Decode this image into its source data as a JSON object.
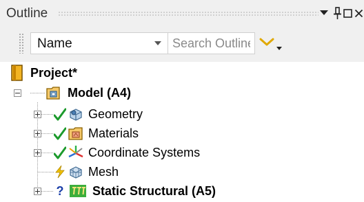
{
  "panel": {
    "title": "Outline",
    "icons": [
      "dropdown-arrow-icon",
      "pin-icon",
      "maximize-icon",
      "close-icon"
    ]
  },
  "toolbar": {
    "name_select_value": "Name",
    "search_placeholder": "Search Outline",
    "icons": [
      "chevron-down-icon",
      "filter-options-icon"
    ]
  },
  "tree": {
    "project": {
      "label": "Project*",
      "icon": "project-book-icon"
    },
    "model": {
      "label": "Model (A4)",
      "icon": "model-icon",
      "expanded": true
    },
    "children": [
      {
        "label": "Geometry",
        "icon": "geometry-icon",
        "status": "check",
        "expandable": true
      },
      {
        "label": "Materials",
        "icon": "materials-icon",
        "status": "check",
        "expandable": true
      },
      {
        "label": "Coordinate Systems",
        "icon": "coordinate-systems-icon",
        "status": "check",
        "expandable": true
      },
      {
        "label": "Mesh",
        "icon": "mesh-icon",
        "status": "lightning",
        "expandable": false
      },
      {
        "label": "Static Structural (A5)",
        "icon": "static-structural-icon",
        "status": "question",
        "expandable": true,
        "bold": true
      }
    ]
  },
  "colors": {
    "chrome_background": "#f0f0f0",
    "status_check": "#1c9a2c",
    "status_lightning": "#e5b100",
    "status_question": "#1a3ea8",
    "accent_yellow": "#e0a800"
  }
}
